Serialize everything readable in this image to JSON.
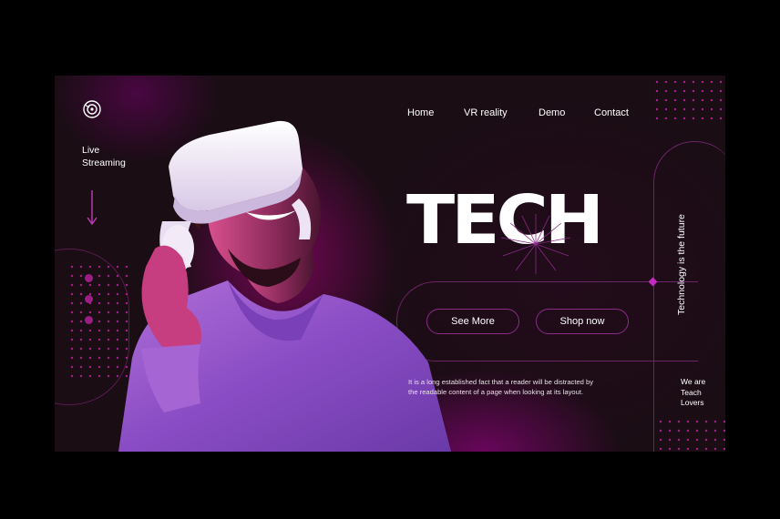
{
  "nav": {
    "items": [
      "Home",
      "VR reality",
      "Demo",
      "Contact"
    ]
  },
  "sidebar": {
    "live_line1": "Live",
    "live_line2": "Streaming",
    "social_icons": [
      "facebook-icon",
      "instagram-icon",
      "twitter-icon"
    ]
  },
  "hero": {
    "title": "TECH",
    "see_more": "See More",
    "shop_now": "Shop now",
    "description_line1": "It is a long established fact that a reader will be distracted by",
    "description_line2": "the readable content of a page when looking at its layout.",
    "tagline": "Technology is the future",
    "we_are_line1": "We are",
    "we_are_line2": "Teach",
    "we_are_line3": "Lovers"
  },
  "colors": {
    "background": "#1a0d14",
    "accent": "#9a1e84",
    "outline": "#6a2566",
    "text": "#ffffff"
  }
}
